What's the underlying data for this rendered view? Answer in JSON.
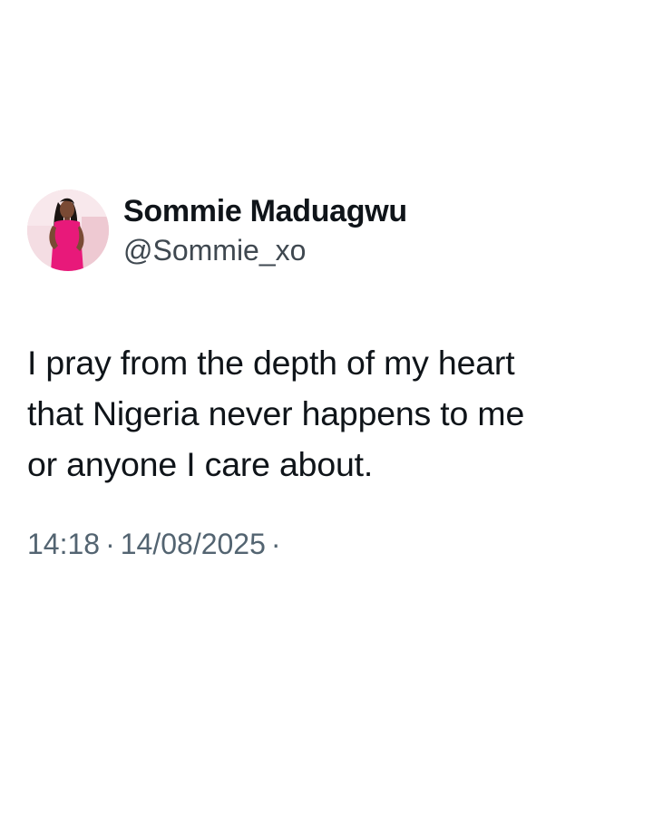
{
  "tweet": {
    "author": {
      "display_name": "Sommie Maduagwu",
      "handle": "@Sommie_xo",
      "avatar_icon": "profile-photo"
    },
    "text_lines": [
      "I pray from the depth of my heart",
      "that Nigeria never happens to me",
      "or anyone I care about."
    ],
    "meta": {
      "time": "14:18",
      "date": "14/08/2025",
      "separator": "·"
    }
  },
  "colors": {
    "background": "#ffffff",
    "text": "#0f1419",
    "secondary_text": "#536471",
    "avatar_dress": "#e8197a"
  }
}
